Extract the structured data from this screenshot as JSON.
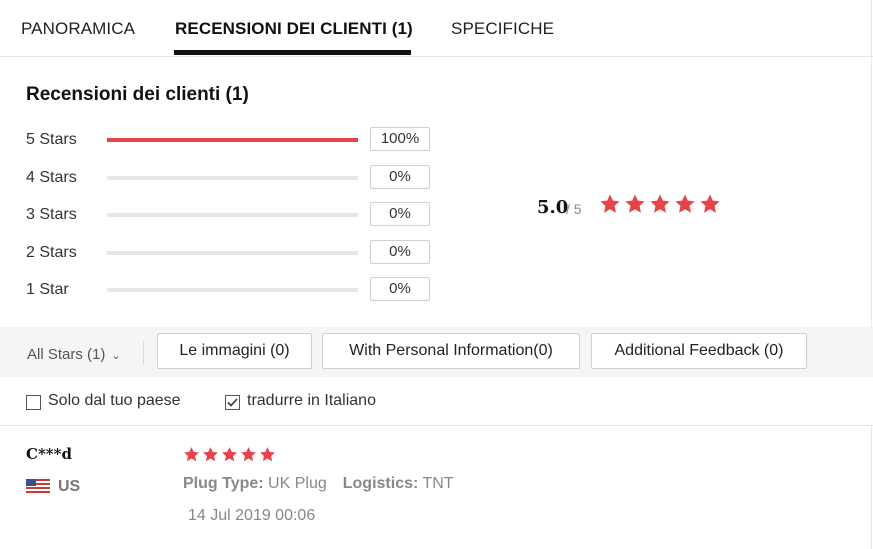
{
  "tabs": [
    {
      "label": "PANORAMICA",
      "active": false
    },
    {
      "label": "RECENSIONI DEI CLIENTI (1)",
      "active": true
    },
    {
      "label": "SPECIFICHE",
      "active": false
    }
  ],
  "summary": {
    "title": "Recensioni dei clienti (1)",
    "rows": [
      {
        "label": "5 Stars",
        "percent_text": "100%",
        "fraction": 1.0
      },
      {
        "label": "4 Stars",
        "percent_text": "0%",
        "fraction": 0
      },
      {
        "label": "3 Stars",
        "percent_text": "0%",
        "fraction": 0
      },
      {
        "label": "2 Stars",
        "percent_text": "0%",
        "fraction": 0
      },
      {
        "label": "1 Star",
        "percent_text": "0%",
        "fraction": 0
      }
    ],
    "average": "5.0",
    "out_of": "/ 5",
    "average_stars": 5
  },
  "filters": {
    "all_stars": "All Stars (1)",
    "buttons": [
      "Le immagini (0)",
      "With Personal Information(0)",
      "Additional Feedback (0)"
    ],
    "checkboxes": [
      {
        "label": "Solo dal tuo paese",
        "checked": false
      },
      {
        "label": "tradurre in Italiano",
        "checked": true
      }
    ]
  },
  "review": {
    "reviewer": "C***d",
    "country": "US",
    "stars": 5,
    "plug_type_label": "Plug Type:",
    "plug_type_value": "UK Plug",
    "logistics_label": "Logistics:",
    "logistics_value": "TNT",
    "date": "14 Jul 2019 00:06"
  },
  "colors": {
    "accent": "#e8434b",
    "star": "#e8434b",
    "tab_underline": "#111111"
  }
}
